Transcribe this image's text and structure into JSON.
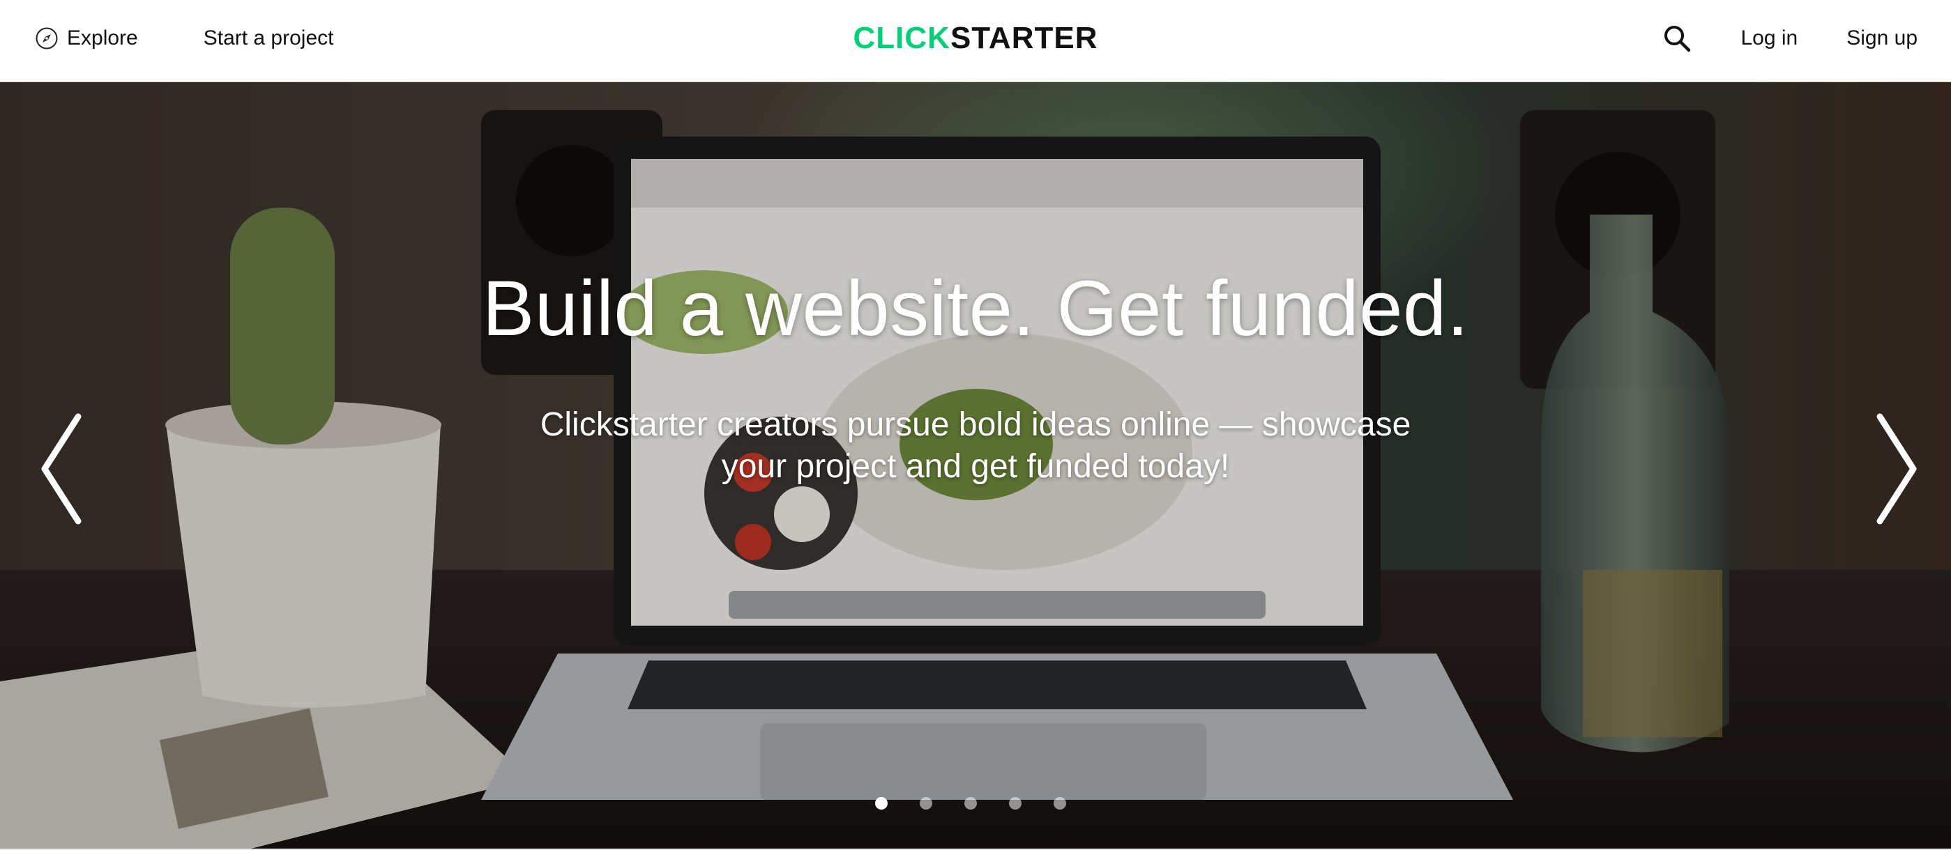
{
  "header": {
    "explore_label": "Explore",
    "start_project_label": "Start a project",
    "logo": {
      "part1": "CLICK",
      "part2": "STARTER"
    },
    "login_label": "Log in",
    "signup_label": "Sign up",
    "icons": [
      "compass-icon",
      "search-icon"
    ]
  },
  "hero": {
    "title": "Build a website. Get funded.",
    "subtitle": "Clickstarter creators pursue bold ideas online — showcase your project and get funded today!",
    "slides_total": 5,
    "active_slide": 1,
    "icons": [
      "chevron-left-icon",
      "chevron-right-icon"
    ]
  },
  "colors": {
    "brand_green": "#05ce78",
    "text_dark": "#111111",
    "hero_text": "#ffffff"
  }
}
